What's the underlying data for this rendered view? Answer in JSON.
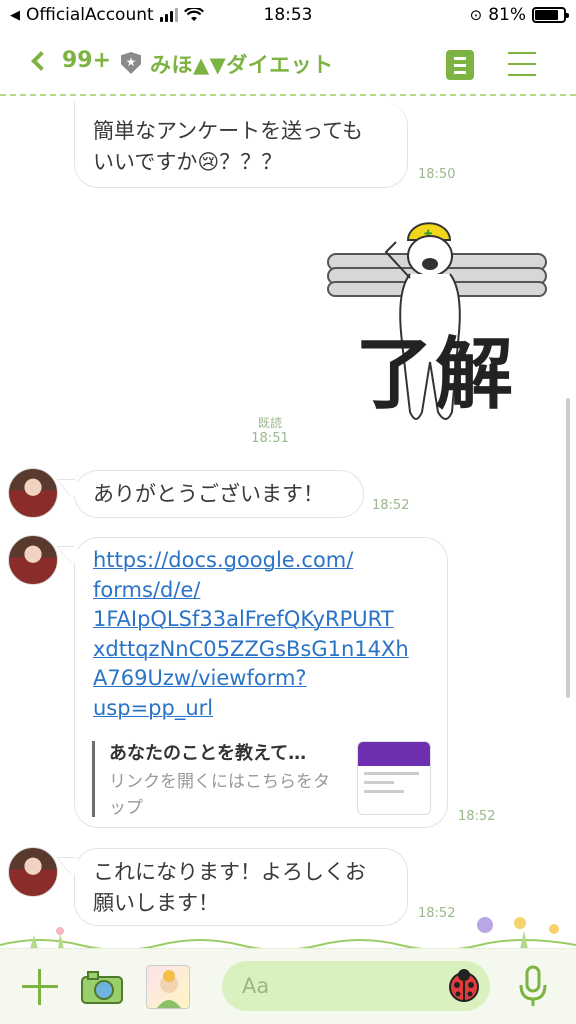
{
  "status_bar": {
    "carrier": "OfficialAccount",
    "time": "18:53",
    "battery": "81%",
    "battery_level": 0.81
  },
  "header": {
    "back_count": "99+",
    "title": "みほ▲▼ダイエット",
    "back_icon": "chevron-left-icon",
    "badge_icon": "shield-star-icon",
    "note_icon": "note-icon",
    "menu_icon": "hamburger-menu-icon"
  },
  "messages": [
    {
      "type": "outgoing",
      "lines": [
        "簡単なアンケートを送っても",
        "いいですか😢？？？"
      ],
      "time": "18:50"
    },
    {
      "type": "outgoing-sticker",
      "sticker_text": "了解",
      "read": "既読",
      "time": "18:51"
    },
    {
      "type": "incoming",
      "text": "ありがとうございます！",
      "time": "18:52"
    },
    {
      "type": "incoming-link",
      "link_lines": [
        "https://docs.google.com/",
        "forms/d/e/",
        "1FAIpQLSf33alFrefQKyRPURT",
        "xdttqzNnC05ZZGsBsG1n14Xh",
        "A769Uzw/viewform?",
        "usp=pp_url"
      ],
      "preview_title": "あなたのことを教えて…",
      "preview_desc": "リンクを開くにはこちらをタップ",
      "time": "18:52"
    },
    {
      "type": "incoming",
      "lines": [
        "これになります！よろしくお",
        "願いします！"
      ],
      "time": "18:52"
    }
  ],
  "input_bar": {
    "placeholder": "Aa"
  },
  "colors": {
    "accent": "#7cb342",
    "link": "#2a73c7",
    "input_bg": "#d9f1bf"
  }
}
